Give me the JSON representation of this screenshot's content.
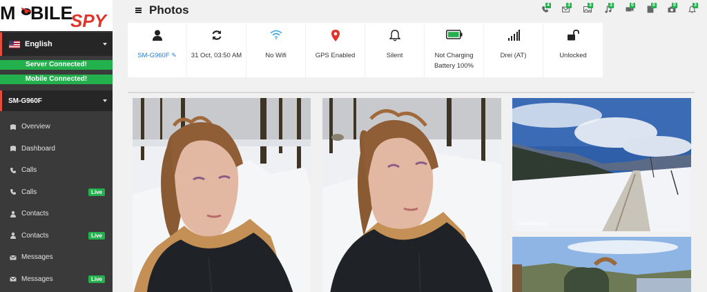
{
  "brand": {
    "logo_part1": "M",
    "logo_part2": "BILE",
    "logo_part3": "SPY",
    "accent": "#e0352b"
  },
  "sidebar": {
    "language": "English",
    "server_status": "Server Connected!",
    "mobile_status": "Mobile Connected!",
    "device": "SM-G960F",
    "items": [
      {
        "label": "Overview",
        "icon": "book-icon"
      },
      {
        "label": "Dashboard",
        "icon": "book-icon"
      },
      {
        "label": "Calls",
        "icon": "phone-icon"
      },
      {
        "label": "Calls",
        "icon": "phone-icon",
        "badge": "Live"
      },
      {
        "label": "Contacts",
        "icon": "user-icon"
      },
      {
        "label": "Contacts",
        "icon": "user-icon",
        "badge": "Live"
      },
      {
        "label": "Messages",
        "icon": "envelope-icon"
      },
      {
        "label": "Messages",
        "icon": "envelope-icon",
        "badge": "Live"
      }
    ]
  },
  "header": {
    "title": "Photos",
    "icons": [
      {
        "name": "call-log-icon",
        "count": "4"
      },
      {
        "name": "mail-icon",
        "count": "3"
      },
      {
        "name": "photos-icon",
        "count": "3"
      },
      {
        "name": "music-icon",
        "count": "3"
      },
      {
        "name": "video-icon",
        "count": "0"
      },
      {
        "name": "document-icon",
        "count": "0"
      },
      {
        "name": "camera-icon",
        "count": "0"
      },
      {
        "name": "bell-icon",
        "count": "3"
      }
    ]
  },
  "status_panel": {
    "device": "SM-G960F",
    "last_sync": "31 Oct, 03:50 AM",
    "wifi": "No Wifi",
    "gps": "GPS Enabled",
    "sound": "Silent",
    "charging": "Not Charging",
    "battery": "Battery 100%",
    "network": "Drei (AT)",
    "lock": "Unlocked"
  },
  "photos": [
    {
      "caption": ""
    },
    {
      "caption": ""
    },
    {
      "caption": "image13.jpeg"
    },
    {
      "caption": ""
    }
  ],
  "colors": {
    "sidebar": "#3a3a3a",
    "green": "#22b14c",
    "red": "#e74c3c",
    "link": "#2a7bd1"
  }
}
